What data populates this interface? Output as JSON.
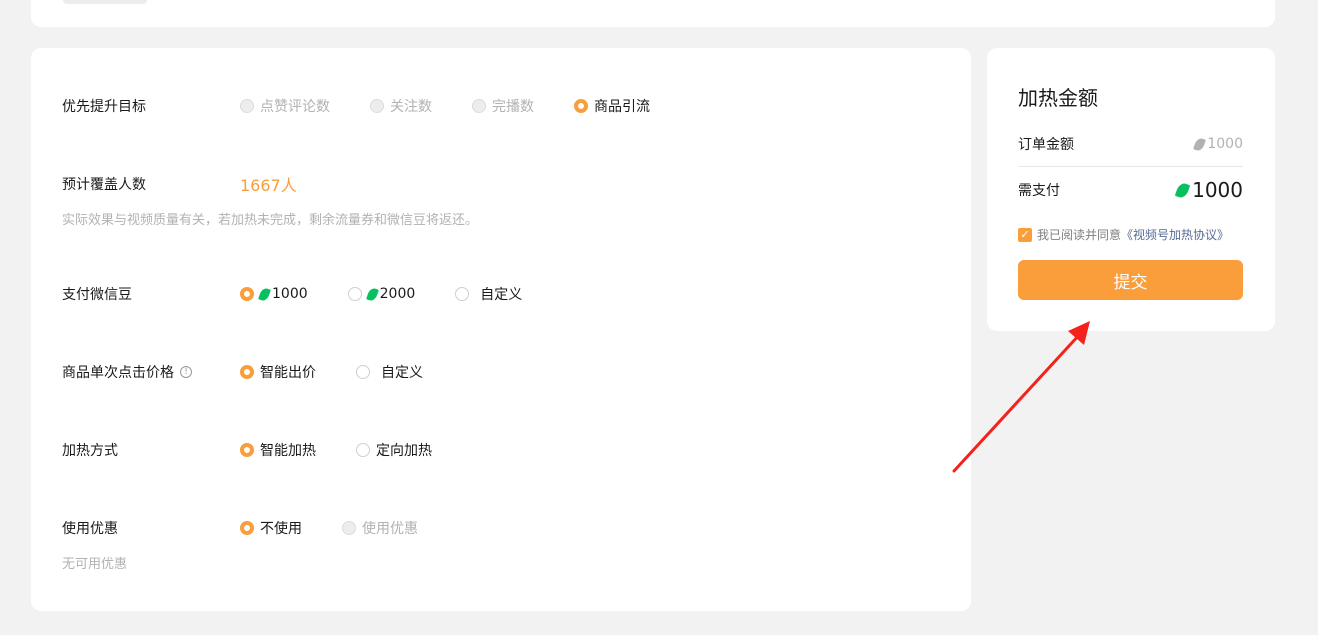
{
  "form": {
    "goal": {
      "label": "优先提升目标",
      "options": [
        {
          "label": "点赞评论数",
          "state": "disabled"
        },
        {
          "label": "关注数",
          "state": "disabled"
        },
        {
          "label": "完播数",
          "state": "disabled"
        },
        {
          "label": "商品引流",
          "state": "checked"
        }
      ]
    },
    "coverage": {
      "label": "预计覆盖人数",
      "value": "1667人",
      "note": "实际效果与视频质量有关，若加热未完成，剩余流量券和微信豆将返还。"
    },
    "pay_beans": {
      "label": "支付微信豆",
      "options": [
        {
          "label": "1000",
          "state": "checked",
          "icon": "bean-icon"
        },
        {
          "label": "2000",
          "state": "unchecked",
          "icon": "bean-icon"
        },
        {
          "label": "自定义",
          "state": "unchecked"
        }
      ]
    },
    "click_price": {
      "label": "商品单次点击价格",
      "info_icon": "info-icon",
      "info_glyph": "!",
      "options": [
        {
          "label": "智能出价",
          "state": "checked"
        },
        {
          "label": "自定义",
          "state": "unchecked"
        }
      ]
    },
    "heat_mode": {
      "label": "加热方式",
      "options": [
        {
          "label": "智能加热",
          "state": "checked"
        },
        {
          "label": "定向加热",
          "state": "unchecked"
        }
      ]
    },
    "discount": {
      "label": "使用优惠",
      "options": [
        {
          "label": "不使用",
          "state": "checked"
        },
        {
          "label": "使用优惠",
          "state": "disabled"
        }
      ],
      "note": "无可用优惠"
    }
  },
  "summary": {
    "title": "加热金额",
    "order_amount_label": "订单金额",
    "order_amount_value": "1000",
    "pay_label": "需支付",
    "pay_value": "1000",
    "agree_prefix": "我已阅读并同意",
    "agree_link": "《视频号加热协议》",
    "submit_label": "提交"
  },
  "colors": {
    "accent": "#fa9d3b",
    "bean": "#07c160",
    "annotation_arrow": "#f5221b"
  }
}
